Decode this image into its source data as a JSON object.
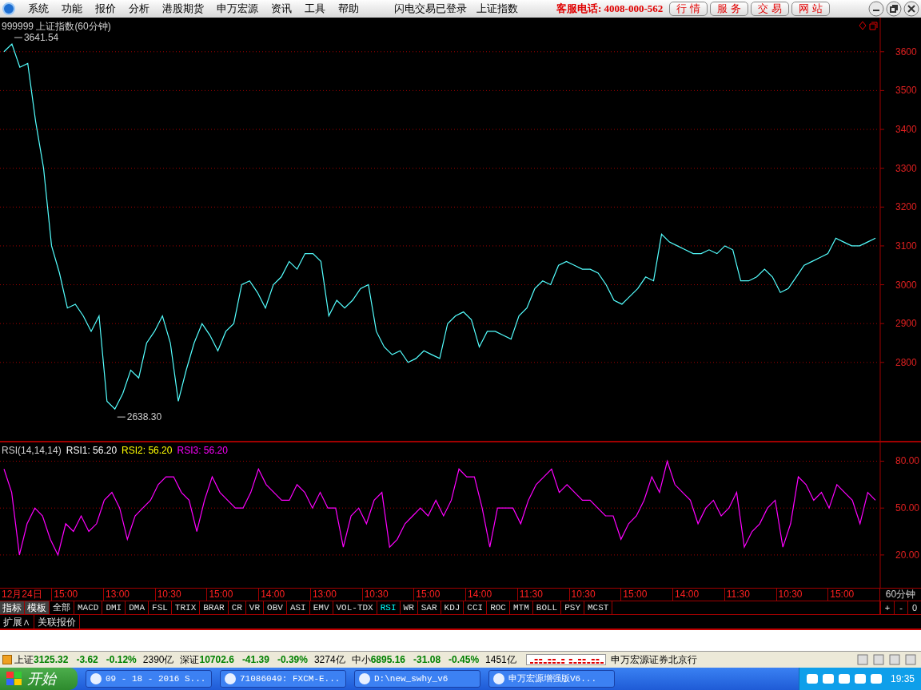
{
  "menu": {
    "items": [
      "系统",
      "功能",
      "报价",
      "分析",
      "港股期货",
      "申万宏源",
      "资讯",
      "工具",
      "帮助"
    ],
    "login_status": "闪电交易已登录",
    "index_name": "上证指数",
    "hotline": "客服电话: 4008-000-562",
    "buttons": [
      "行 情",
      "服 务",
      "交 易",
      "网 站"
    ]
  },
  "price_chart": {
    "title": "999999 上证指数(60分钟)",
    "chart_data": {
      "type": "line",
      "ylim": [
        2596,
        3688
      ],
      "yticks": [
        2800,
        2900,
        3000,
        3100,
        3200,
        3300,
        3400,
        3500,
        3600
      ],
      "grid": true,
      "series": [
        {
          "color": "#54ffff",
          "values": [
            3600,
            3620,
            3560,
            3570,
            3420,
            3300,
            3100,
            3030,
            2940,
            2950,
            2920,
            2880,
            2920,
            2700,
            2680,
            2720,
            2780,
            2760,
            2850,
            2880,
            2920,
            2850,
            2700,
            2780,
            2850,
            2900,
            2870,
            2830,
            2880,
            2900,
            3000,
            3010,
            2980,
            2940,
            3000,
            3020,
            3060,
            3040,
            3080,
            3080,
            3060,
            2920,
            2960,
            2940,
            2960,
            2990,
            3000,
            2880,
            2840,
            2820,
            2830,
            2800,
            2810,
            2830,
            2820,
            2810,
            2900,
            2920,
            2930,
            2910,
            2840,
            2880,
            2880,
            2870,
            2860,
            2920,
            2940,
            2990,
            3010,
            3000,
            3050,
            3060,
            3050,
            3040,
            3040,
            3030,
            3000,
            2960,
            2950,
            2970,
            2990,
            3020,
            3010,
            3130,
            3110,
            3100,
            3090,
            3080,
            3080,
            3090,
            3080,
            3100,
            3090,
            3010,
            3010,
            3020,
            3040,
            3020,
            2980,
            2990,
            3020,
            3050,
            3060,
            3070,
            3080,
            3120,
            3110,
            3100,
            3100,
            3110,
            3120
          ]
        }
      ],
      "annotations": [
        {
          "text": "3641.54"
        },
        {
          "text": "2638.30"
        }
      ]
    }
  },
  "rsi_chart": {
    "title": "RSI(14,14,14)",
    "readings": [
      {
        "label": "RSI1: 56.20",
        "color": "#ffffff"
      },
      {
        "label": "RSI2: 56.20",
        "color": "#ffff00"
      },
      {
        "label": "RSI3: 56.20",
        "color": "#ff00ff"
      }
    ],
    "chart_data": {
      "type": "line",
      "ylim": [
        -1,
        92
      ],
      "yticks": [
        {
          "value": 20,
          "label": "20.00"
        },
        {
          "value": 50,
          "label": "50.00"
        },
        {
          "value": 80,
          "label": "80.00"
        }
      ],
      "grid": true,
      "series": [
        {
          "color": "#ff00ff",
          "values": [
            75,
            60,
            20,
            40,
            50,
            45,
            30,
            20,
            40,
            35,
            45,
            35,
            40,
            55,
            60,
            50,
            30,
            45,
            50,
            55,
            65,
            70,
            70,
            60,
            55,
            35,
            55,
            70,
            60,
            55,
            50,
            50,
            60,
            75,
            65,
            60,
            55,
            55,
            65,
            60,
            50,
            60,
            50,
            50,
            25,
            45,
            50,
            40,
            55,
            60,
            25,
            30,
            40,
            45,
            50,
            45,
            55,
            45,
            55,
            75,
            70,
            70,
            50,
            25,
            50,
            50,
            50,
            40,
            55,
            65,
            70,
            75,
            60,
            65,
            60,
            55,
            55,
            50,
            45,
            45,
            30,
            40,
            45,
            55,
            70,
            60,
            80,
            65,
            60,
            55,
            40,
            50,
            55,
            45,
            50,
            60,
            25,
            35,
            40,
            50,
            55,
            25,
            40,
            70,
            65,
            55,
            60,
            50,
            65,
            60,
            55,
            40,
            60,
            55
          ]
        }
      ]
    }
  },
  "time_axis": {
    "labels": [
      "12月24日",
      "15:00",
      "13:00",
      "10:30",
      "15:00",
      "14:00",
      "13:00",
      "10:30",
      "15:00",
      "14:00",
      "11:30",
      "10:30",
      "15:00",
      "14:00",
      "11:30",
      "10:30",
      "15:00"
    ],
    "period": "60分钟"
  },
  "indicator_bar": {
    "buttons": [
      "指标",
      "模板"
    ],
    "tabs": [
      {
        "label": "全部",
        "selected": false
      },
      {
        "label": "MACD",
        "selected": false
      },
      {
        "label": "DMI",
        "selected": false
      },
      {
        "label": "DMA",
        "selected": false
      },
      {
        "label": "FSL",
        "selected": false
      },
      {
        "label": "TRIX",
        "selected": false
      },
      {
        "label": "BRAR",
        "selected": false
      },
      {
        "label": "CR",
        "selected": false
      },
      {
        "label": "VR",
        "selected": false
      },
      {
        "label": "OBV",
        "selected": false
      },
      {
        "label": "ASI",
        "selected": false
      },
      {
        "label": "EMV",
        "selected": false
      },
      {
        "label": "VOL-TDX",
        "selected": false
      },
      {
        "label": "RSI",
        "selected": true
      },
      {
        "label": "WR",
        "selected": false
      },
      {
        "label": "SAR",
        "selected": false
      },
      {
        "label": "KDJ",
        "selected": false
      },
      {
        "label": "CCI",
        "selected": false
      },
      {
        "label": "ROC",
        "selected": false
      },
      {
        "label": "MTM",
        "selected": false
      },
      {
        "label": "BOLL",
        "selected": false
      },
      {
        "label": "PSY",
        "selected": false
      },
      {
        "label": "MCST",
        "selected": false
      }
    ],
    "zoom_buttons": [
      "+",
      "-",
      "0"
    ]
  },
  "extra_tabs": [
    "扩展∧",
    "关联报价"
  ],
  "status_bar": {
    "indices": [
      {
        "name": "上证",
        "value": "3125.32",
        "change": "-3.62",
        "pct": "-0.12%",
        "amount": "2390亿"
      },
      {
        "name": "深证",
        "value": "10702.6",
        "change": "-41.39",
        "pct": "-0.39%",
        "amount": "3274亿"
      },
      {
        "name": "中小",
        "value": "6895.16",
        "change": "-31.08",
        "pct": "-0.45%",
        "amount": "1451亿"
      }
    ],
    "broker": "申万宏源证券北京行"
  },
  "taskbar": {
    "start": "开始",
    "tasks": [
      "09 - 18 - 2016 S...",
      "71086049: FXCM-E...",
      "D:\\new_swhy_v6",
      "申万宏源增强版V6..."
    ],
    "clock": "19:35"
  }
}
